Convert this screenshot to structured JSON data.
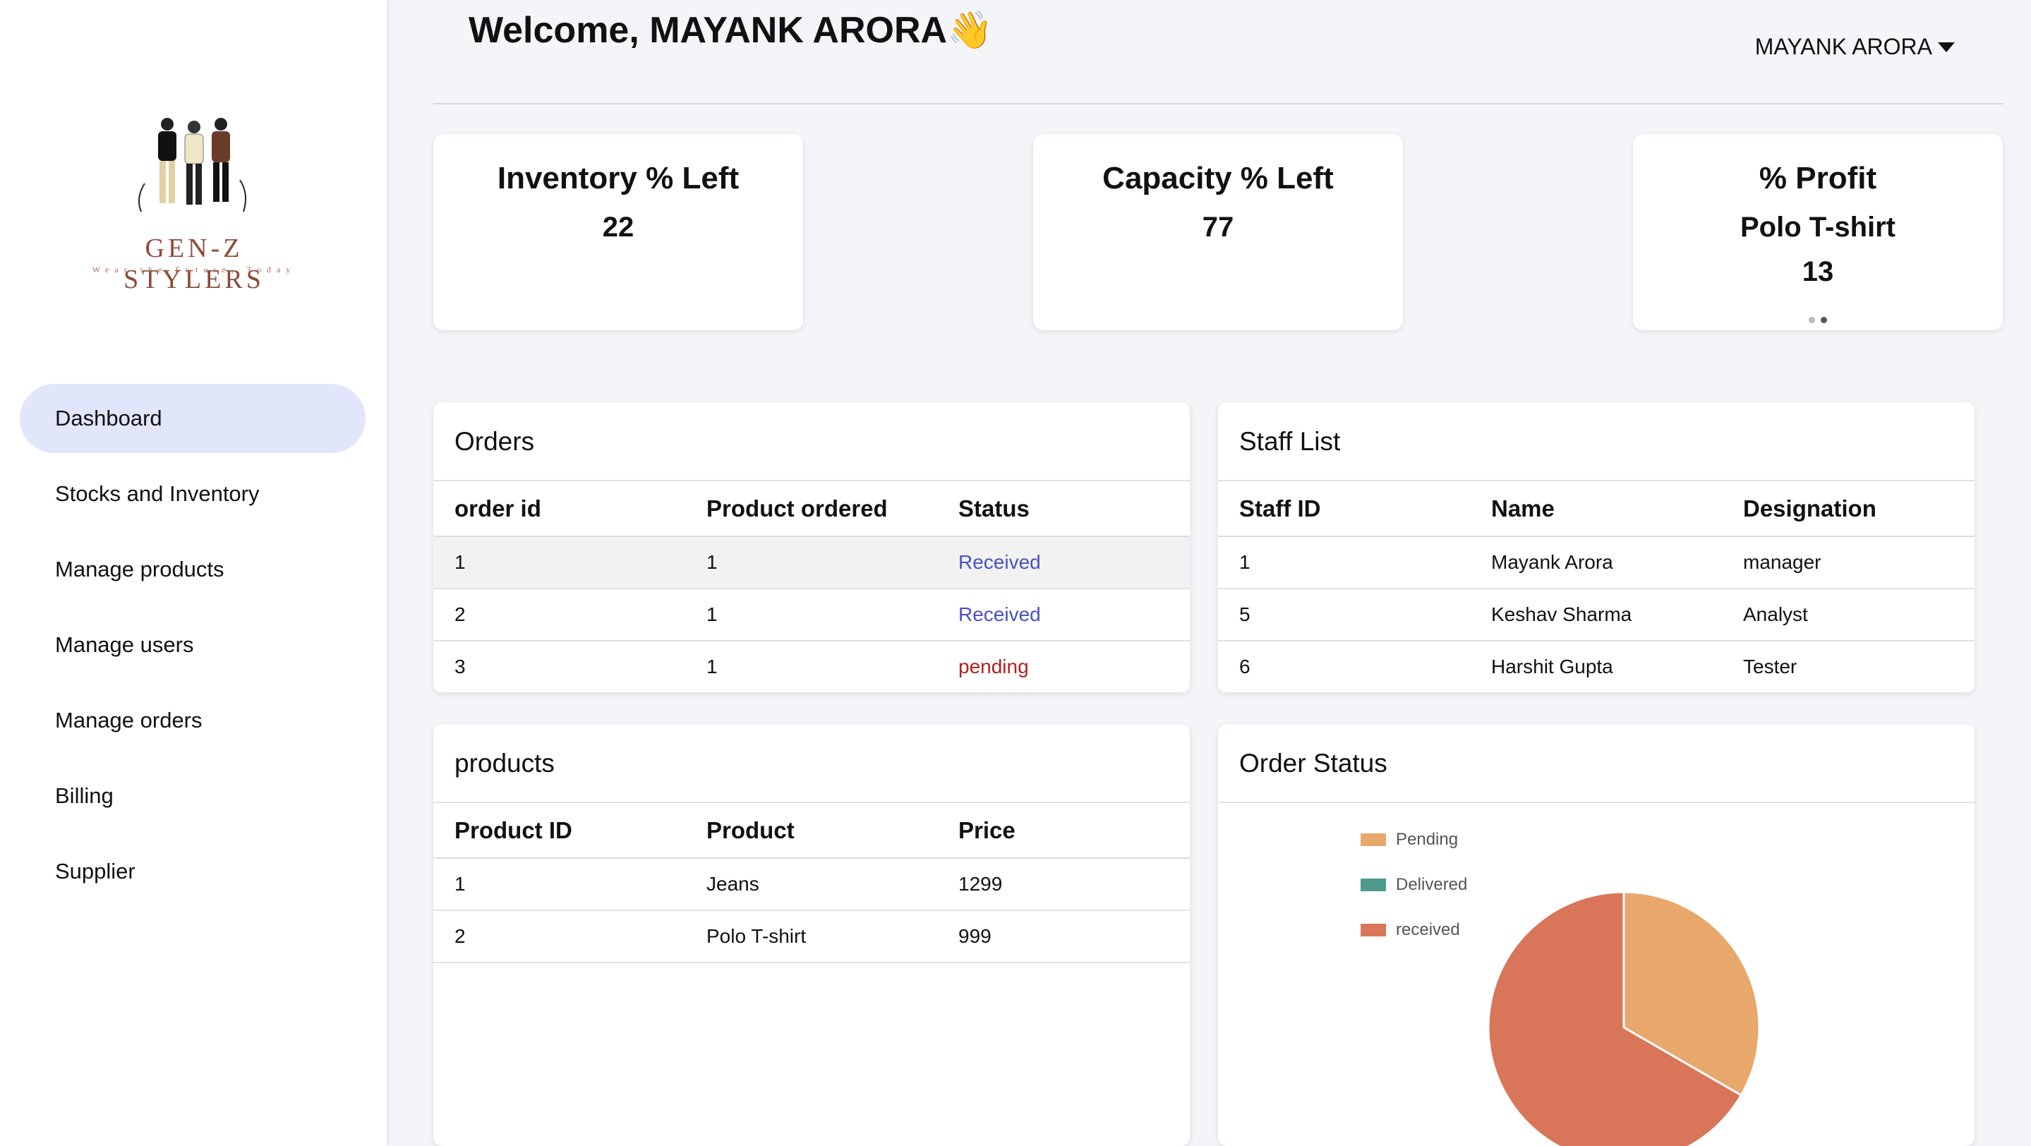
{
  "sidebar": {
    "logo": {
      "name": "GEN-Z STYLERS",
      "tagline": "Wear the Future, Today"
    },
    "items": [
      {
        "label": "Dashboard",
        "active": true
      },
      {
        "label": "Stocks and Inventory"
      },
      {
        "label": "Manage products"
      },
      {
        "label": "Manage users"
      },
      {
        "label": "Manage orders"
      },
      {
        "label": "Billing"
      },
      {
        "label": "Supplier"
      }
    ]
  },
  "header": {
    "welcome": "Welcome, MAYANK ARORA👋",
    "user": "MAYANK ARORA"
  },
  "stats": {
    "inventory": {
      "title": "Inventory % Left",
      "value": "22"
    },
    "capacity": {
      "title": "Capacity % Left",
      "value": "77"
    },
    "profit": {
      "title": "% Profit",
      "product": "Polo T-shirt",
      "value": "13"
    }
  },
  "orders": {
    "title": "Orders",
    "headers": [
      "order id",
      "Product ordered",
      "Status"
    ],
    "rows": [
      [
        "1",
        "1",
        "Received"
      ],
      [
        "2",
        "1",
        "Received"
      ],
      [
        "3",
        "1",
        "pending"
      ]
    ]
  },
  "staff": {
    "title": "Staff List",
    "headers": [
      "Staff ID",
      "Name",
      "Designation"
    ],
    "rows": [
      [
        "1",
        "Mayank Arora",
        "manager"
      ],
      [
        "5",
        "Keshav Sharma",
        "Analyst"
      ],
      [
        "6",
        "Harshit Gupta",
        "Tester"
      ]
    ]
  },
  "products": {
    "title": "products",
    "headers": [
      "Product ID",
      "Product",
      "Price"
    ],
    "rows": [
      [
        "1",
        "Jeans",
        "1299"
      ],
      [
        "2",
        "Polo T-shirt",
        "999"
      ]
    ]
  },
  "order_status": {
    "title": "Order Status"
  },
  "colors": {
    "active_nav": "#e1e6fb",
    "received": "#4a51c4",
    "pending": "#b02020"
  },
  "chart_data": {
    "type": "pie",
    "categories": [
      "Pending",
      "Delivered",
      "received"
    ],
    "values": [
      1,
      0,
      2
    ],
    "colors": [
      "#e8a76b",
      "#4e9a8c",
      "#d9765a"
    ],
    "legend": "left"
  }
}
